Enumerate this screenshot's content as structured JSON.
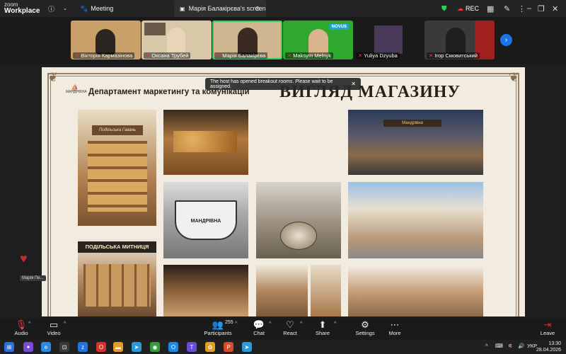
{
  "app": {
    "logo_line1": "zoom",
    "logo_line2": "Workplace",
    "meeting_label": "Meeting"
  },
  "share_tab": {
    "label": "Марія Балакірєва's screen"
  },
  "rec_label": "REC",
  "participants": [
    {
      "name": "Вікторія Кармазінова",
      "muted": true,
      "bg": "#c9a06a"
    },
    {
      "name": "Оксана Трубей",
      "muted": true,
      "bg": "#d8c8a8"
    },
    {
      "name": "Марія Балакірєва",
      "muted": true,
      "bg": "#cfb590"
    },
    {
      "name": "Maksym Melnyk",
      "muted": true,
      "bg": "#2ea82e"
    },
    {
      "name": "Yuliya Dzyuba",
      "muted": true,
      "bg": "#4a3a5a"
    },
    {
      "name": "Ігор Смовитський",
      "muted": true,
      "bg": "#3a3a3a"
    }
  ],
  "thumb_labels": {
    "novus": "NOVUS"
  },
  "slide": {
    "dept_title": "Департамент маркетингу та комунікацій",
    "main_title": "ВИГЛЯД МАГАЗИНУ",
    "brand": "МАНДРІВНА",
    "img_text_1": "Подільська Гавань",
    "img_text_2": "МАНДРІВНА",
    "img_text_3": "ПОДІЛЬСЬКА МИТНИЦЯ",
    "img_text_4": "Мандрівна"
  },
  "toast": {
    "text": "The host has opened breakout rooms. Please wait to be assigned."
  },
  "reaction": {
    "label": "Марія Пе..."
  },
  "controls": {
    "audio": "Audio",
    "video": "Video",
    "participants": "Participants",
    "participants_count": "255",
    "chat": "Chat",
    "react": "React",
    "share": "Share",
    "settings": "Settings",
    "more": "More",
    "leave": "Leave"
  },
  "taskbar": {
    "lang": "УКР",
    "time": "13:30",
    "date": "28.04.2026"
  },
  "colors": {
    "accent": "#1d73e8",
    "leave": "#e02828",
    "mute": "#e34545"
  }
}
